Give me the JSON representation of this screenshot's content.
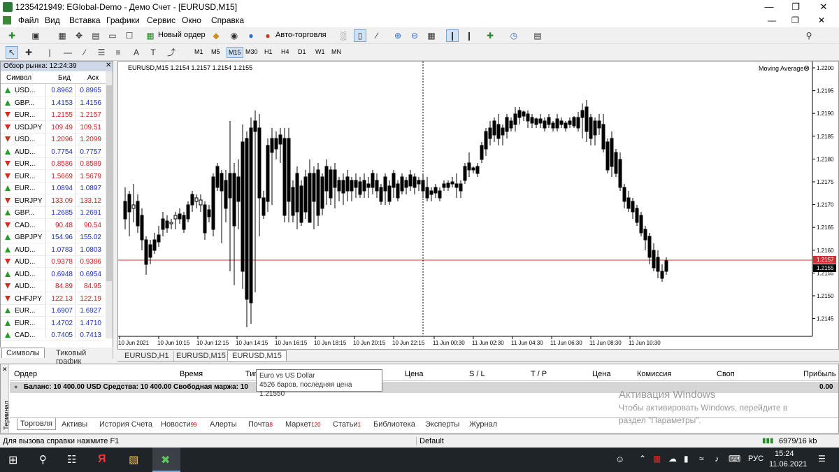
{
  "window": {
    "title": "1235421949: EGlobal-Demo - Демо Счет - [EURUSD,M15]"
  },
  "menu": [
    "Файл",
    "Вид",
    "Вставка",
    "Графики",
    "Сервис",
    "Окно",
    "Справка"
  ],
  "toolbar": {
    "new_order": "Новый ордер",
    "autotrading": "Авто-торговля",
    "notif_count": "1"
  },
  "timeframes": [
    "M1",
    "M5",
    "M15",
    "M30",
    "H1",
    "H4",
    "D1",
    "W1",
    "MN"
  ],
  "timeframe_selected": "M15",
  "market_watch": {
    "header": "Обзор рынка: 12:24:39",
    "col_symbol": "Символ",
    "col_bid": "Бид",
    "col_ask": "Аск",
    "rows": [
      {
        "sym": "USD...",
        "bid": "0.8962",
        "ask": "0.8965",
        "dir": "up",
        "c": "blue"
      },
      {
        "sym": "GBP...",
        "bid": "1.4153",
        "ask": "1.4156",
        "dir": "up",
        "c": "blue"
      },
      {
        "sym": "EUR...",
        "bid": "1.2155",
        "ask": "1.2157",
        "dir": "dn",
        "c": "red"
      },
      {
        "sym": "USDJPY",
        "bid": "109.49",
        "ask": "109.51",
        "dir": "dn",
        "c": "red"
      },
      {
        "sym": "USD...",
        "bid": "1.2096",
        "ask": "1.2099",
        "dir": "dn",
        "c": "red"
      },
      {
        "sym": "AUD...",
        "bid": "0.7754",
        "ask": "0.7757",
        "dir": "up",
        "c": "blue"
      },
      {
        "sym": "EUR...",
        "bid": "0.8586",
        "ask": "0.8589",
        "dir": "dn",
        "c": "red"
      },
      {
        "sym": "EUR...",
        "bid": "1.5669",
        "ask": "1.5679",
        "dir": "dn",
        "c": "red"
      },
      {
        "sym": "EUR...",
        "bid": "1.0894",
        "ask": "1.0897",
        "dir": "up",
        "c": "blue"
      },
      {
        "sym": "EURJPY",
        "bid": "133.09",
        "ask": "133.12",
        "dir": "dn",
        "c": "red"
      },
      {
        "sym": "GBP...",
        "bid": "1.2685",
        "ask": "1.2691",
        "dir": "up",
        "c": "blue"
      },
      {
        "sym": "CAD...",
        "bid": "90.48",
        "ask": "90.54",
        "dir": "dn",
        "c": "red"
      },
      {
        "sym": "GBPJPY",
        "bid": "154.96",
        "ask": "155.02",
        "dir": "up",
        "c": "blue"
      },
      {
        "sym": "AUD...",
        "bid": "1.0783",
        "ask": "1.0803",
        "dir": "up",
        "c": "blue"
      },
      {
        "sym": "AUD...",
        "bid": "0.9378",
        "ask": "0.9386",
        "dir": "dn",
        "c": "red"
      },
      {
        "sym": "AUD...",
        "bid": "0.6948",
        "ask": "0.6954",
        "dir": "up",
        "c": "blue"
      },
      {
        "sym": "AUD...",
        "bid": "84.89",
        "ask": "84.95",
        "dir": "dn",
        "c": "red"
      },
      {
        "sym": "CHFJPY",
        "bid": "122.13",
        "ask": "122.19",
        "dir": "dn",
        "c": "red"
      },
      {
        "sym": "EUR...",
        "bid": "1.6907",
        "ask": "1.6927",
        "dir": "up",
        "c": "blue"
      },
      {
        "sym": "EUR...",
        "bid": "1.4702",
        "ask": "1.4710",
        "dir": "up",
        "c": "blue"
      },
      {
        "sym": "CAD...",
        "bid": "0.7405",
        "ask": "0.7413",
        "dir": "up",
        "c": "blue"
      }
    ],
    "tabs": [
      "Символы",
      "Тиковый график"
    ]
  },
  "chart": {
    "header": "EURUSD,M15  1.2154 1.2157 1.2154 1.2155",
    "indicator": "Moving Average",
    "price_labels": [
      "1.2200",
      "1.2195",
      "1.2190",
      "1.2185",
      "1.2180",
      "1.2175",
      "1.2170",
      "1.2165",
      "1.2160",
      "1.2155",
      "1.2150",
      "1.2145"
    ],
    "ask_label": "1.2157",
    "bid_label": "1.2155",
    "time_labels": [
      "10 Jun 2021",
      "10 Jun 10:15",
      "10 Jun 12:15",
      "10 Jun 14:15",
      "10 Jun 16:15",
      "10 Jun 18:15",
      "10 Jun 20:15",
      "10 Jun 22:15",
      "11 Jun 00:30",
      "11 Jun 02:30",
      "11 Jun 04:30",
      "11 Jun 06:30",
      "11 Jun 08:30",
      "11 Jun 10:30"
    ],
    "tabs": [
      "EURUSD,H1",
      "EURUSD,M15",
      "EURUSD,M15"
    ]
  },
  "tooltip": {
    "line1": "Euro vs US Dollar",
    "line2": "4526 баров, последняя цена 1.21550"
  },
  "terminal": {
    "side_label": "Терминал",
    "cols": [
      "Ордер",
      "Время",
      "Тип",
      "Цена",
      "S / L",
      "T / P",
      "Цена",
      "Комиссия",
      "Своп",
      "Прибыль"
    ],
    "balance": "Баланс: 10 400.00 USD  Средства: 10 400.00  Свободная маржа: 10",
    "profit": "0.00",
    "tabs": [
      {
        "label": "Торговля",
        "n": ""
      },
      {
        "label": "Активы",
        "n": ""
      },
      {
        "label": "История Счета",
        "n": ""
      },
      {
        "label": "Новости",
        "n": "99"
      },
      {
        "label": "Алерты",
        "n": ""
      },
      {
        "label": "Почта",
        "n": "8"
      },
      {
        "label": "Маркет",
        "n": "120"
      },
      {
        "label": "Статьи",
        "n": "1"
      },
      {
        "label": "Библиотека",
        "n": ""
      },
      {
        "label": "Эксперты",
        "n": ""
      },
      {
        "label": "Журнал",
        "n": ""
      }
    ]
  },
  "status": {
    "help": "Для вызова справки нажмите F1",
    "profile": "Default",
    "traffic": "6979/16 kb"
  },
  "activation": {
    "title": "Активация Windows",
    "line1": "Чтобы активировать Windows, перейдите в",
    "line2": "раздел \"Параметры\"."
  },
  "taskbar": {
    "lang": "РУС",
    "time": "15:24",
    "date": "11.06.2021"
  }
}
